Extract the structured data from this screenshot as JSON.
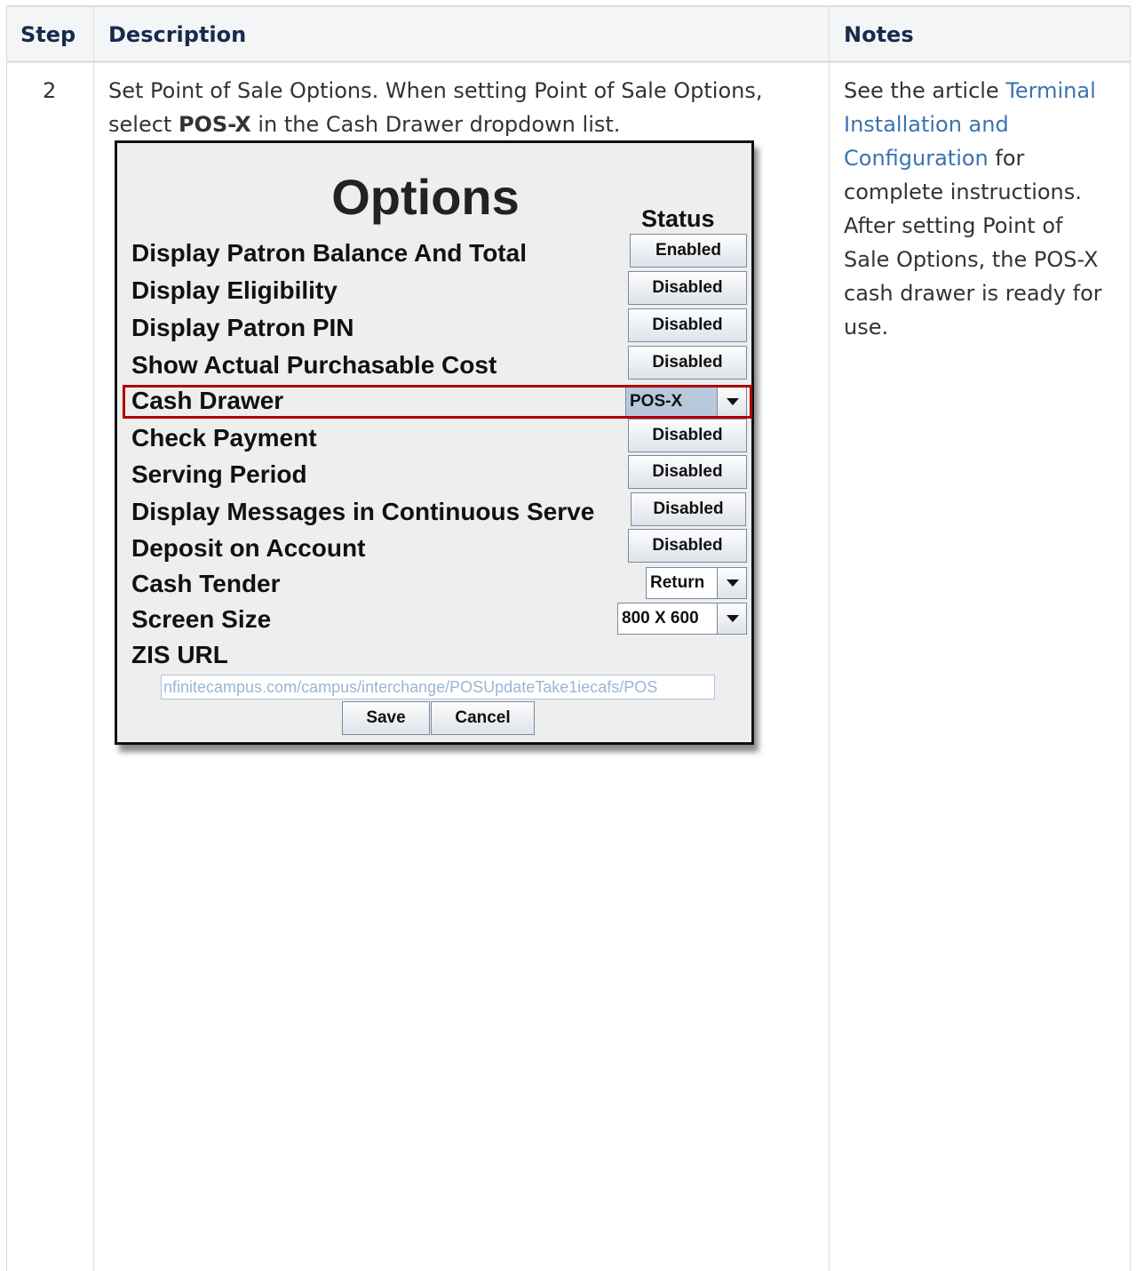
{
  "table": {
    "headers": {
      "step": "Step",
      "description": "Description",
      "notes": "Notes"
    },
    "row": {
      "step": "2",
      "description": {
        "line1": "Set Point of Sale Options. When setting Point of Sale Options,",
        "line2_pre": "select ",
        "line2_bold": "POS-X",
        "line2_post": " in the Cash Drawer dropdown list."
      },
      "notes": {
        "pre": "See the article ",
        "link_line1": "Terminal",
        "link_line2": "Installation and",
        "link_line3": "Configuration",
        "post_line1": " for",
        "line4": "complete instructions.",
        "line5": "After setting Point of",
        "line6": "Sale Options, the POS-X",
        "line7": "cash drawer is ready for",
        "line8": "use."
      }
    }
  },
  "dialog": {
    "title": "Options",
    "status_header": "Status",
    "rows": [
      {
        "label": "Display Patron Balance And Total",
        "control": "button",
        "value": "Enabled"
      },
      {
        "label": "Display Eligibility",
        "control": "button",
        "value": "Disabled"
      },
      {
        "label": "Display Patron PIN",
        "control": "button",
        "value": "Disabled"
      },
      {
        "label": "Show Actual Purchasable Cost",
        "control": "button",
        "value": "Disabled"
      },
      {
        "label": "Cash Drawer",
        "control": "dropdown",
        "value": "POS-X"
      },
      {
        "label": "Check Payment",
        "control": "button",
        "value": "Disabled"
      },
      {
        "label": "Serving Period",
        "control": "button",
        "value": "Disabled"
      },
      {
        "label": "Display Messages in Continuous Serve",
        "control": "button",
        "value": "Disabled"
      },
      {
        "label": "Deposit on Account",
        "control": "button",
        "value": "Disabled"
      },
      {
        "label": "Cash Tender",
        "control": "dropdown",
        "value": "Return"
      },
      {
        "label": "Screen Size",
        "control": "dropdown",
        "value": "800 X 600"
      },
      {
        "label": "ZIS URL",
        "control": "none",
        "value": ""
      }
    ],
    "zis_url_value": "nfinitecampus.com/campus/interchange/POSUpdateTake1iecafs/POS",
    "save_label": "Save",
    "cancel_label": "Cancel",
    "highlight_color": "#b00000"
  }
}
